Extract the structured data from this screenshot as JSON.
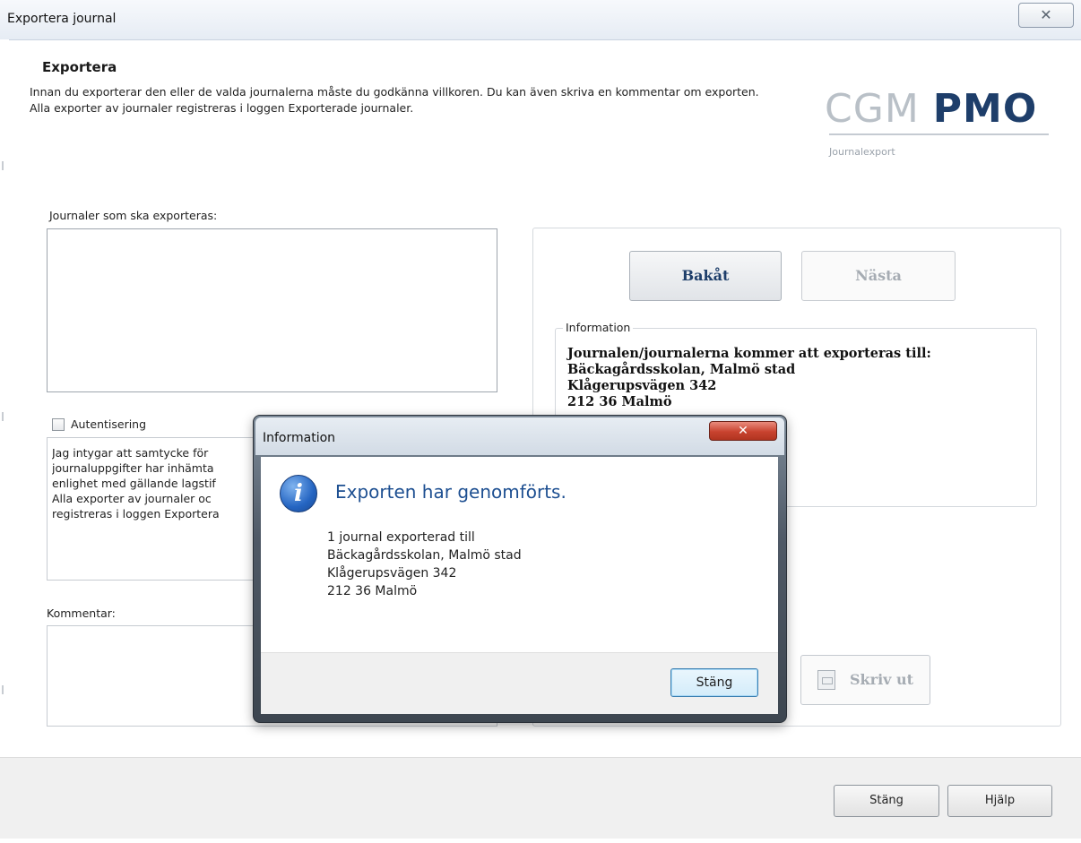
{
  "window": {
    "title": "Exportera journal",
    "close_glyph": "✕"
  },
  "header": {
    "title": "Exportera",
    "description": "Innan du exporterar den eller de valda journalerna måste du godkänna villkoren. Du kan även skriva en kommentar om exporten. Alla exporter av journaler registreras i loggen Exporterade journaler."
  },
  "logo": {
    "cgm": "CGM",
    "pmo": "PMO",
    "subtitle": "Journalexport"
  },
  "journals": {
    "label": "Journaler som ska exporteras:"
  },
  "auth": {
    "checkbox_label": "Autentisering",
    "checked": false,
    "lines": [
      "Jag intygar att samtycke för",
      "journaluppgifter har inhämta",
      "enlighet med gällande lagstif",
      "Alla exporter av journaler oc",
      "registreras i loggen Exportera"
    ]
  },
  "comment": {
    "label": "Kommentar:"
  },
  "nav": {
    "back_label": "Bakåt",
    "next_label": "Nästa"
  },
  "info_panel": {
    "legend": "Information",
    "lines": [
      "Journalen/journalerna kommer att exporteras till:",
      "Bäckagårdsskolan, Malmö stad",
      "Klågerupsvägen 342",
      "212 36 Malmö"
    ]
  },
  "print": {
    "label": "Skriv ut",
    "icon": "printer-icon"
  },
  "footer": {
    "close_label": "Stäng",
    "help_label": "Hjälp"
  },
  "dialog": {
    "title": "Information",
    "close_glyph": "✕",
    "icon_glyph": "i",
    "heading": "Exporten har genomförts.",
    "message_lines": [
      "1 journal exporterad till",
      "Bäckagårdsskolan, Malmö stad",
      "Klågerupsvägen 342",
      "212 36 Malmö"
    ],
    "ok_label": "Stäng"
  }
}
